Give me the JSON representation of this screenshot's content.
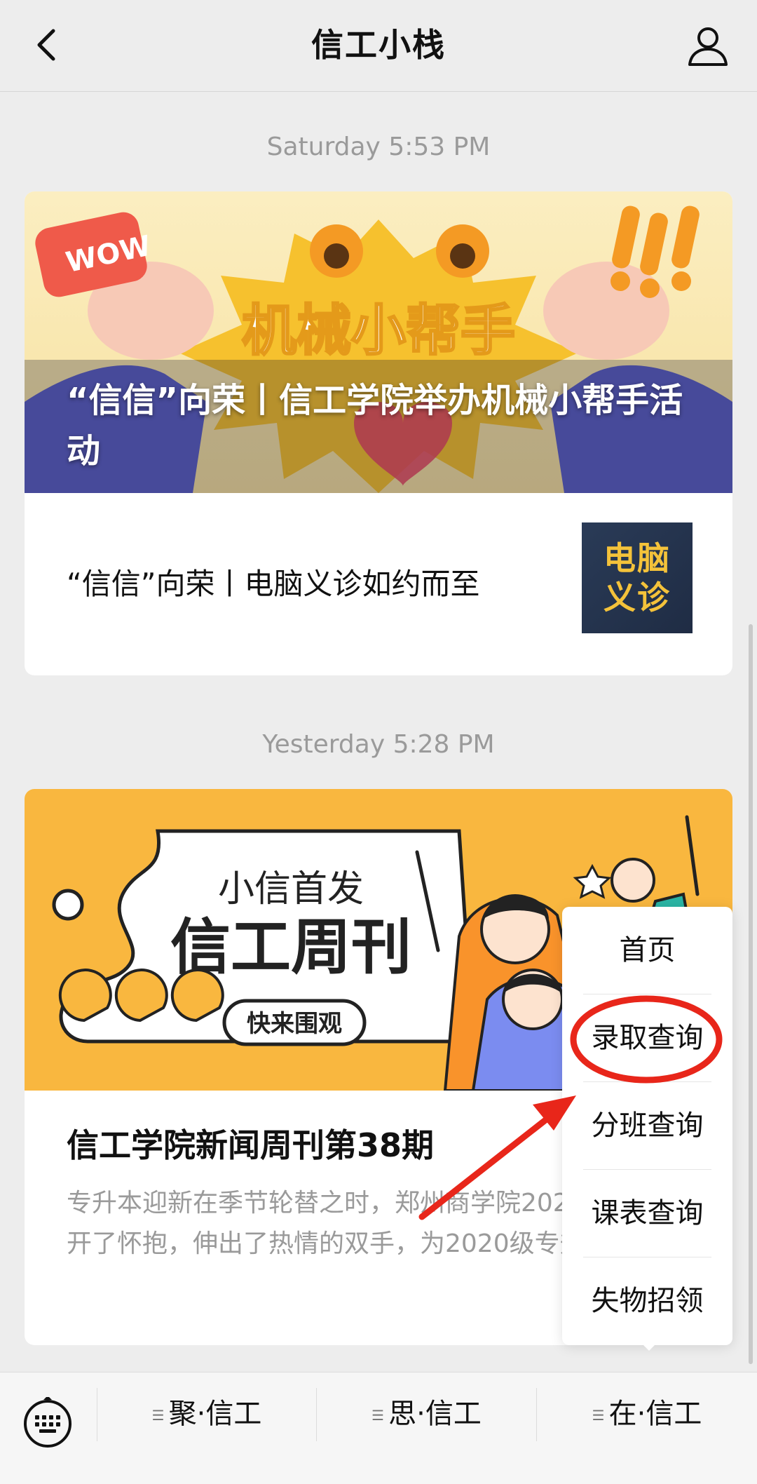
{
  "header": {
    "title": "信工小栈"
  },
  "messages": [
    {
      "timestamp": "Saturday 5:53 PM",
      "cover": {
        "art_text": "机械小帮手",
        "title": "“信信”向荣丨信工学院举办机械小帮手活动"
      },
      "list_item": {
        "text": "“信信”向荣丨电脑义诊如约而至",
        "thumb_line1": "电脑",
        "thumb_line2": "义诊"
      }
    },
    {
      "timestamp": "Yesterday 5:28 PM",
      "cover": {
        "art_line1": "小信首发",
        "art_line2": "信工周刊",
        "badge": "快来围观"
      },
      "title": "信工学院新闻周刊第38期",
      "summary": "专升本迎新在季节轮替之时，郑州商学院2020级新生敞开了怀抱，伸出了热情的双手，为2020级专升本新生入"
    }
  ],
  "popup_menu": {
    "items": [
      "首页",
      "录取查询",
      "分班查询",
      "课表查询",
      "失物招领"
    ],
    "highlighted_index": 1,
    "highlight_color": "#e8261a"
  },
  "bottom_bar": {
    "tabs": [
      "聚·信工",
      "思·信工",
      "在·信工"
    ],
    "tab_icon": "menu-lines-icon",
    "keyboard_icon": "keyboard-icon"
  },
  "colors": {
    "page_background": "#ededed",
    "cover2_background": "#f9b73f",
    "thumb_text": "#f4c23a",
    "annotation_red": "#e8261a"
  }
}
